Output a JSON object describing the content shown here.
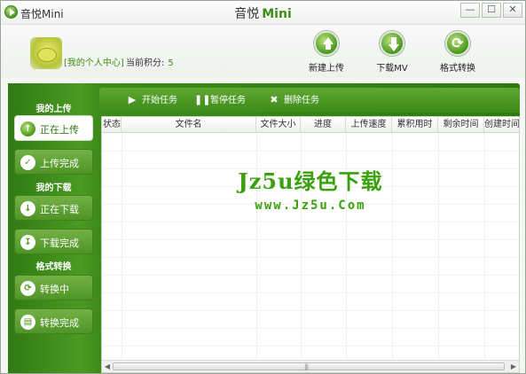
{
  "window": {
    "app_name": "音悦Mini",
    "title_main": "音悦",
    "title_accent": "Mini",
    "controls": [
      "—",
      "☐",
      "✕"
    ]
  },
  "profile": {
    "link_text": "[我的个人中心]",
    "points_label": "当前积分:",
    "points_value": "5"
  },
  "toolbar": {
    "new_upload": "新建上传",
    "download_mv": "下载MV",
    "format_convert": "格式转换"
  },
  "sidebar": {
    "upload_section": "我的上传",
    "download_section": "我的下载",
    "convert_section": "格式转换",
    "uploading": "正在上传",
    "upload_done": "上传完成",
    "downloading": "正在下载",
    "download_done": "下载完成",
    "converting": "转换中",
    "convert_done": "转换完成"
  },
  "tasks": {
    "start": "开始任务",
    "pause": "暂停任务",
    "delete": "删除任务"
  },
  "table": {
    "columns": [
      "状态",
      "文件名",
      "文件大小",
      "进度",
      "上传速度",
      "累积用时",
      "剩余时间",
      "创建时间"
    ]
  },
  "watermark": {
    "main": "Jz5u绿色下载",
    "sub": "www.Jz5u.Com"
  },
  "colors": {
    "brand_green": "#3e8e12",
    "watermark_green": "#3aa10e"
  }
}
